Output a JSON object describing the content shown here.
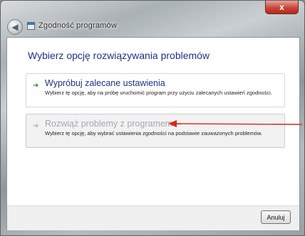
{
  "window": {
    "title": "Zgodność programów",
    "close_label": "x",
    "back_glyph": "◀",
    "icons": {
      "back": "back-arrow-icon",
      "app": "program-compatibility-icon",
      "close": "close-icon"
    }
  },
  "main": {
    "heading": "Wybierz opcję rozwiązywania problemów",
    "options": [
      {
        "glyph": "➜",
        "title": "Wypróbuj zalecane ustawienia",
        "description": "Wybierz tę opcję, aby na próbę uruchomić program przy użyciu zalecanych ustawień zgodności."
      },
      {
        "glyph": "➜",
        "title": "Rozwiąż problemy z programem",
        "description": "Wybierz tę opcję, aby wybrać ustawienia zgodności na podstawie zauważonych problemów."
      }
    ]
  },
  "footer": {
    "cancel_label": "Anuluj"
  },
  "colors": {
    "heading": "#1e3287",
    "annotation_arrow": "#d9261c"
  }
}
